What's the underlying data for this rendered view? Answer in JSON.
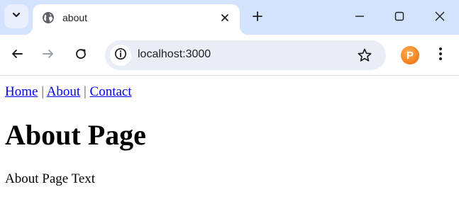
{
  "browser": {
    "tab": {
      "title": "about"
    },
    "address_bar": {
      "url": "localhost:3000"
    },
    "profile": {
      "initial": "P"
    }
  },
  "page": {
    "nav_links": [
      "Home",
      "About",
      "Contact"
    ],
    "separator": "|",
    "heading": "About Page",
    "text": "About Page Text"
  },
  "colors": {
    "tabstrip_bg": "#d3e3fd",
    "omnibox_bg": "#e9eef6",
    "link": "#0000ee",
    "profile_avatar": "#f07d1a"
  }
}
